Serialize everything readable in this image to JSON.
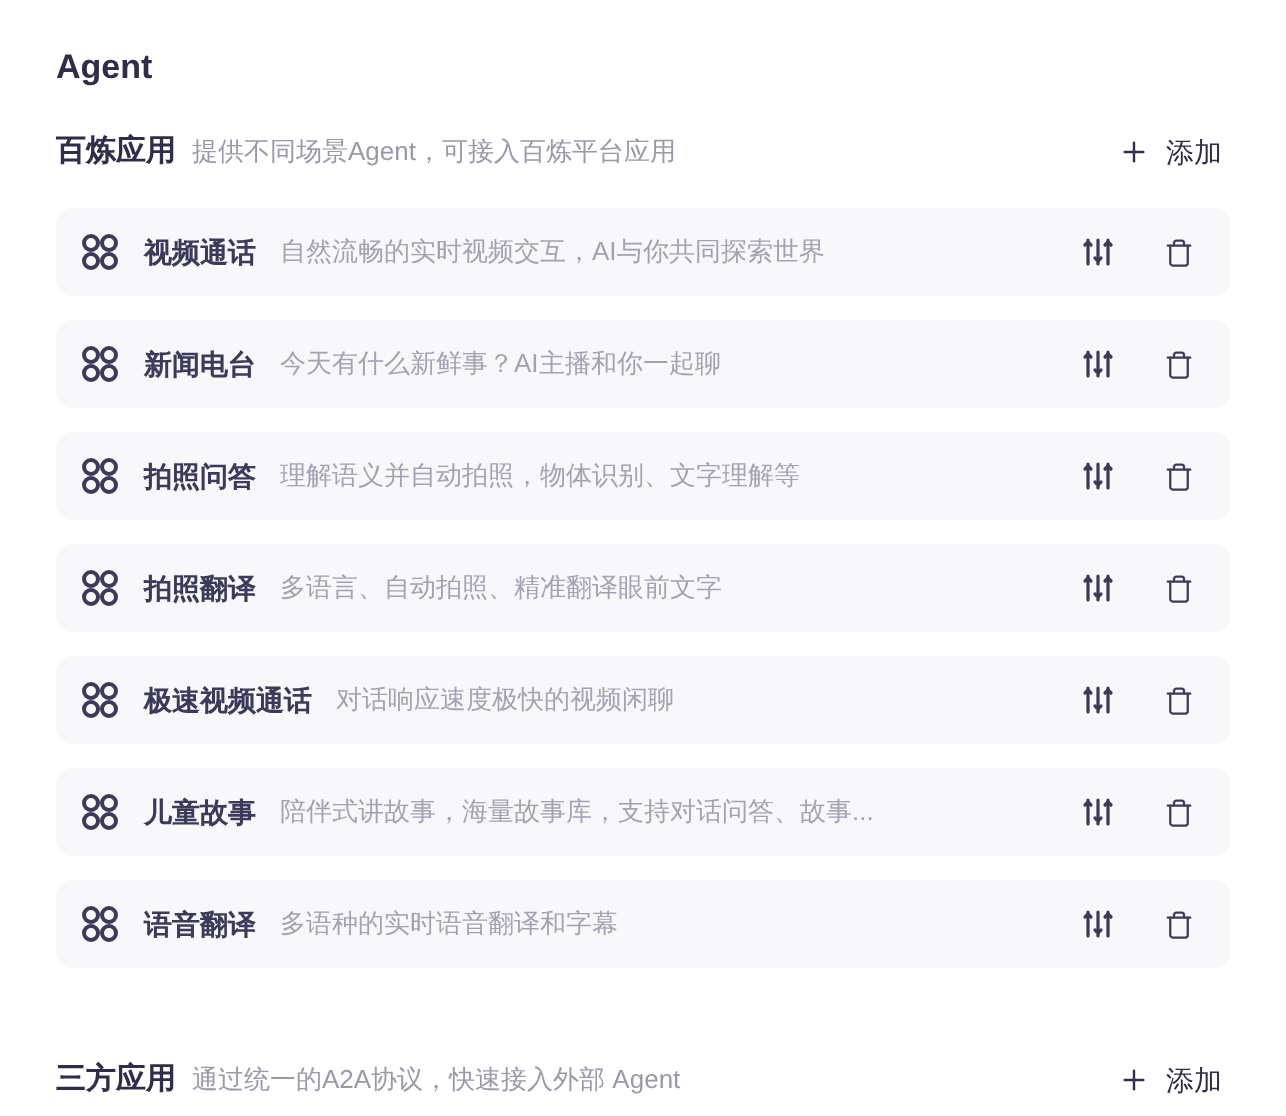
{
  "title": "Agent",
  "sections": [
    {
      "name": "百炼应用",
      "description": "提供不同场景Agent，可接入百炼平台应用",
      "add_label": "添加",
      "items": [
        {
          "name": "视频通话",
          "description": "自然流畅的实时视频交互，AI与你共同探索世界"
        },
        {
          "name": "新闻电台",
          "description": "今天有什么新鲜事？AI主播和你一起聊"
        },
        {
          "name": "拍照问答",
          "description": "理解语义并自动拍照，物体识别、文字理解等"
        },
        {
          "name": "拍照翻译",
          "description": "多语言、自动拍照、精准翻译眼前文字"
        },
        {
          "name": "极速视频通话",
          "description": "对话响应速度极快的视频闲聊"
        },
        {
          "name": "儿童故事",
          "description": "陪伴式讲故事，海量故事库，支持对话问答、故事..."
        },
        {
          "name": "语音翻译",
          "description": "多语种的实时语音翻译和字幕"
        }
      ]
    },
    {
      "name": "三方应用",
      "description": "通过统一的A2A协议，快速接入外部 Agent",
      "add_label": "添加"
    }
  ]
}
